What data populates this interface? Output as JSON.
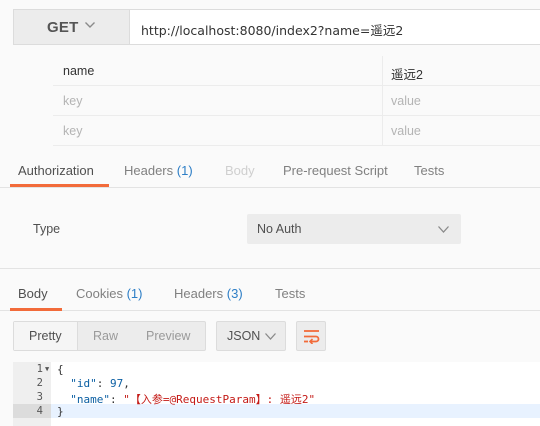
{
  "request": {
    "method": "GET",
    "url": "http://localhost:8080/index2?name=遥远2"
  },
  "params": [
    {
      "key": "name",
      "value": "遥远2",
      "is_placeholder": false
    },
    {
      "key": "key",
      "value": "value",
      "is_placeholder": true
    },
    {
      "key": "key",
      "value": "value",
      "is_placeholder": true
    }
  ],
  "request_tabs": [
    {
      "label": "Authorization",
      "active": true
    },
    {
      "label": "Headers",
      "count": "(1)"
    },
    {
      "label": "Body",
      "disabled": true
    },
    {
      "label": "Pre-request Script"
    },
    {
      "label": "Tests"
    }
  ],
  "auth": {
    "type_label": "Type",
    "type_value": "No Auth"
  },
  "response_tabs": [
    {
      "label": "Body",
      "active": true
    },
    {
      "label": "Cookies",
      "count": "(1)"
    },
    {
      "label": "Headers",
      "count": "(3)"
    },
    {
      "label": "Tests"
    }
  ],
  "response_toolbar": {
    "formats": [
      "Pretty",
      "Raw",
      "Preview"
    ],
    "selected_format": "Pretty",
    "language": "JSON",
    "wrap_icon": "wrap-lines-icon"
  },
  "code": {
    "line_numbers": [
      "1",
      "2",
      "3",
      "4"
    ],
    "lines": [
      {
        "parts": [
          [
            "punc",
            "{"
          ]
        ]
      },
      {
        "parts": [
          [
            "punc",
            "  "
          ],
          [
            "key",
            "\"id\""
          ],
          [
            "punc",
            ": "
          ],
          [
            "num",
            "97"
          ],
          [
            "punc",
            ","
          ]
        ]
      },
      {
        "parts": [
          [
            "punc",
            "  "
          ],
          [
            "key",
            "\"name\""
          ],
          [
            "punc",
            ": "
          ],
          [
            "str",
            "\"【入参=@RequestParam】: 遥远2\""
          ]
        ]
      },
      {
        "parts": [
          [
            "punc",
            "}"
          ]
        ]
      }
    ]
  },
  "colors": {
    "accent": "#f26b3a",
    "count": "#2d7ec6"
  }
}
